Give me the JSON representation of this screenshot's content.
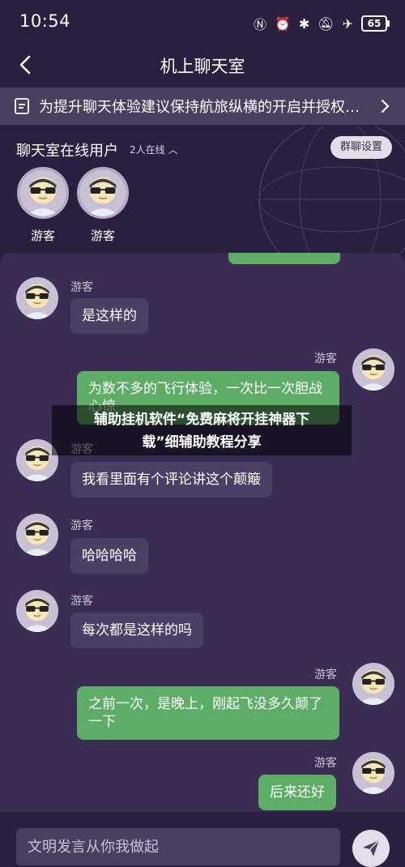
{
  "status_bar": {
    "time": "10:54",
    "battery": "65"
  },
  "header": {
    "title": "机上聊天室"
  },
  "notice": {
    "text": "为提升聊天体验建议保持航旅纵横的开启并授权…"
  },
  "online": {
    "title": "聊天室在线用户",
    "count_label": "2人在线",
    "settings_label": "群聊设置",
    "users": [
      {
        "name": "游客"
      },
      {
        "name": "游客"
      }
    ]
  },
  "messages": [
    {
      "direction": "in",
      "sender": "游客",
      "text": "是这样的"
    },
    {
      "direction": "out",
      "sender": "游客",
      "text": "为数不多的飞行体验，一次比一次胆战心惊"
    },
    {
      "direction": "in",
      "sender": "游客",
      "text": "我看里面有个评论讲这个颠簸"
    },
    {
      "direction": "in",
      "sender": "游客",
      "text": "哈哈哈哈"
    },
    {
      "direction": "in",
      "sender": "游客",
      "text": "每次都是这样的吗"
    },
    {
      "direction": "out",
      "sender": "游客",
      "text": "之前一次，是晚上，刚起飞没多久颠了一下"
    },
    {
      "direction": "out",
      "sender": "游客",
      "text": "后来还好"
    }
  ],
  "overlay": {
    "line1": "辅助挂机软件“免费麻将开挂神器下",
    "line2": "载”细辅助教程分享"
  },
  "input": {
    "placeholder": "文明发言从你我做起"
  },
  "colors": {
    "background": "#2b1f3f",
    "panel": "#3a2c53",
    "bubble_in": "#4c3f66",
    "bubble_out": "#5dad66"
  }
}
